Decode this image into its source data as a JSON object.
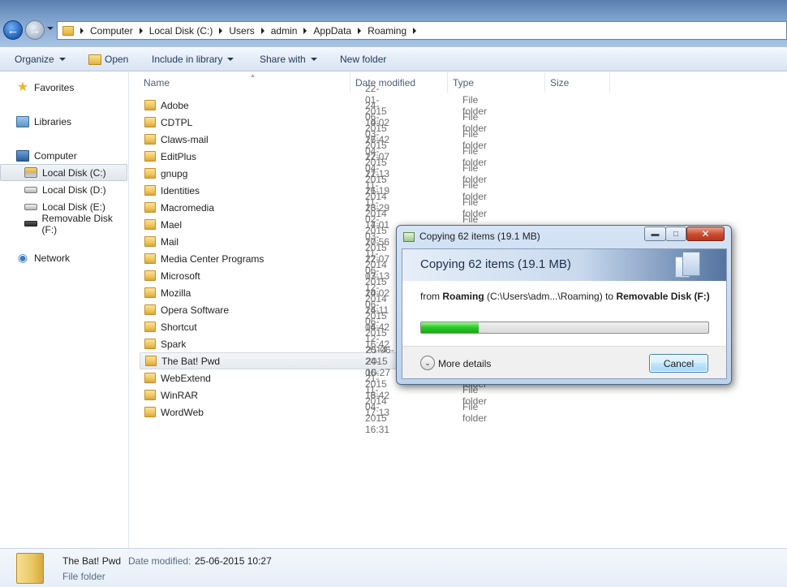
{
  "address": {
    "crumbs": [
      "Computer",
      "Local Disk (C:)",
      "Users",
      "admin",
      "AppData",
      "Roaming"
    ]
  },
  "toolbar": {
    "organize": "Organize",
    "open": "Open",
    "include": "Include in library",
    "share": "Share with",
    "new_folder": "New folder"
  },
  "nav": {
    "favorites": "Favorites",
    "libraries": "Libraries",
    "computer": "Computer",
    "disk_c": "Local Disk (C:)",
    "disk_d": "Local Disk (D:)",
    "disk_e": "Local Disk (E:)",
    "removable": "Removable Disk (F:)",
    "network": "Network"
  },
  "columns": {
    "name": "Name",
    "date": "Date modified",
    "type": "Type",
    "size": "Size"
  },
  "files": [
    {
      "name": "Adobe",
      "date": "22-01-2015 10:02",
      "type": "File folder"
    },
    {
      "name": "CDTPL",
      "date": "24-06-2015 16:42",
      "type": "File folder"
    },
    {
      "name": "Claws-mail",
      "date": "14-03-2015 17:07",
      "type": "File folder"
    },
    {
      "name": "EditPlus",
      "date": "27-04-2015 12:13",
      "type": "File folder"
    },
    {
      "name": "gnupg",
      "date": "22-04-2015 16:19",
      "type": "File folder"
    },
    {
      "name": "Identities",
      "date": "21-11-2014 16:29",
      "type": "File folder"
    },
    {
      "name": "Macromedia",
      "date": "21-11-2014 17:01",
      "type": "File folder"
    },
    {
      "name": "Mael",
      "date": "23-02-2015 17:56",
      "type": "File folder"
    },
    {
      "name": "Mail",
      "date": "14-03-2015 17:07",
      "type": "File folder"
    },
    {
      "name": "Media Center Programs",
      "date": "20-11-2014 17:13",
      "type": "File folder"
    },
    {
      "name": "Microsoft",
      "date": "22-06-2015 10:02",
      "type": "File folder"
    },
    {
      "name": "Mozilla",
      "date": "03-12-2014 16:11",
      "type": "File folder"
    },
    {
      "name": "Opera Software",
      "date": "24-06-2015 16:42",
      "type": "File folder"
    },
    {
      "name": "Shortcut",
      "date": "24-06-2015 16:42",
      "type": "File folder"
    },
    {
      "name": "Spark",
      "date": "04-12-2014 16:11",
      "type": "File folder"
    },
    {
      "name": "The Bat! Pwd",
      "date": "25-06-2015 10:27",
      "type": "File folder"
    },
    {
      "name": "WebExtend",
      "date": "24-06-2015 16:42",
      "type": "File folder"
    },
    {
      "name": "WinRAR",
      "date": "21-11-2014 17:13",
      "type": "File folder"
    },
    {
      "name": "WordWeb",
      "date": "18-04-2015 16:31",
      "type": "File folder"
    }
  ],
  "details": {
    "name": "The Bat! Pwd",
    "modified_label": "Date modified:",
    "modified_value": "25-06-2015 10:27",
    "type": "File folder"
  },
  "dialog": {
    "title": "Copying 62 items (19.1 MB)",
    "heading": "Copying 62 items (19.1 MB)",
    "from_word": "from",
    "source_name": "Roaming",
    "source_path": "(C:\\Users\\adm...\\Roaming)",
    "to_word": "to",
    "dest_name": "Removable Disk (F:)",
    "progress": 0.2,
    "more_details": "More details",
    "cancel": "Cancel",
    "progress_color": "#2fcc2a"
  }
}
